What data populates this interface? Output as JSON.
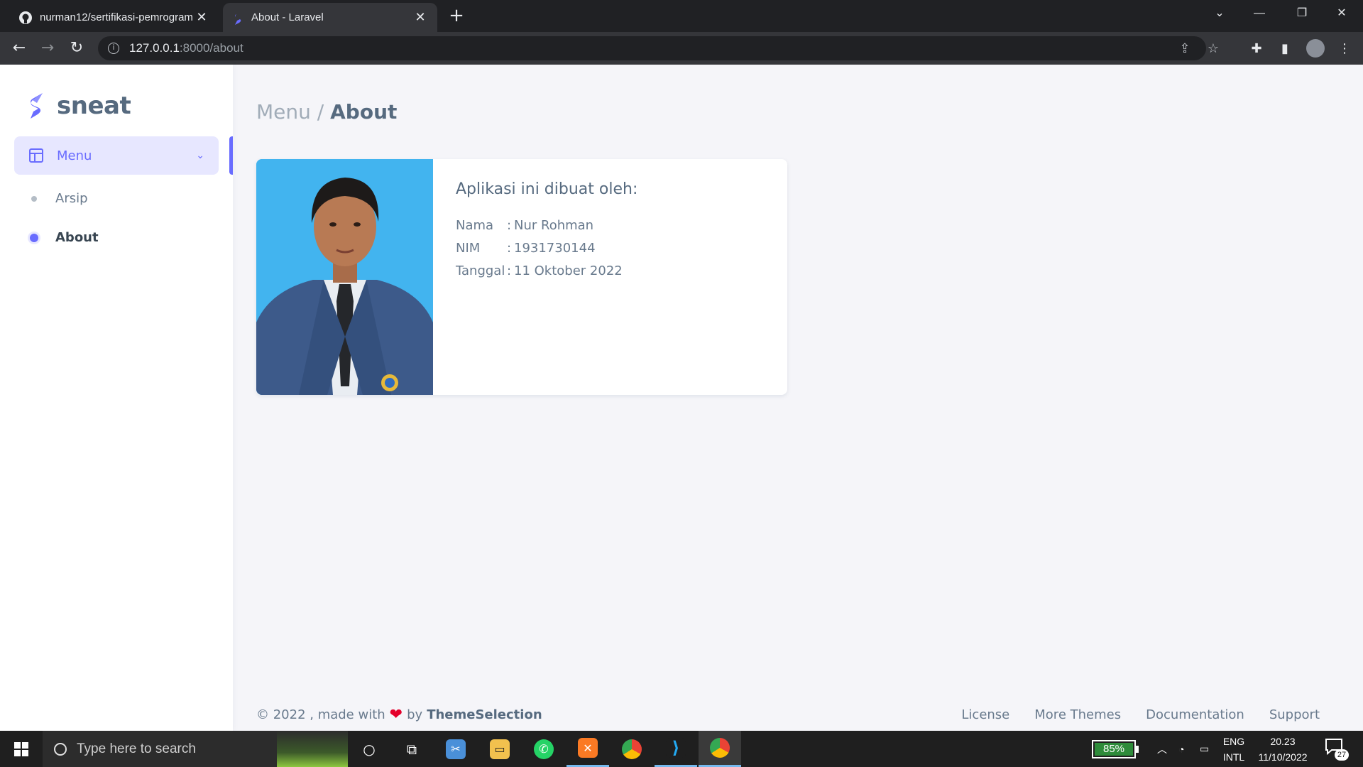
{
  "browser": {
    "tabs": [
      {
        "title": "nurman12/sertifikasi-pemrogram",
        "icon": "github-icon"
      },
      {
        "title": "About - Laravel",
        "icon": "sneat-icon"
      }
    ],
    "url_host": "127.0.0.1",
    "url_path": ":8000/about",
    "window_controls": {
      "minimize": "—",
      "restore": "❐",
      "close": "✕"
    }
  },
  "app": {
    "brand": "sneat",
    "accent": "#696cff",
    "sidebar": {
      "menu_label": "Menu",
      "items": [
        {
          "label": "Arsip",
          "active": false
        },
        {
          "label": "About",
          "active": true
        }
      ]
    },
    "breadcrumb": {
      "parent": "Menu /",
      "current": "About"
    },
    "card": {
      "title": "Aplikasi ini dibuat oleh:",
      "rows": [
        {
          "key": "Nama",
          "sep": ":",
          "value": "Nur Rohman"
        },
        {
          "key": "NIM",
          "sep": ":",
          "value": "1931730144"
        },
        {
          "key": "Tanggal",
          "sep": ":",
          "value": "11 Oktober 2022"
        }
      ]
    },
    "footer": {
      "copyright": "© 2022 , made with",
      "by": "by",
      "company": "ThemeSelection",
      "links": [
        "License",
        "More Themes",
        "Documentation",
        "Support"
      ]
    }
  },
  "taskbar": {
    "search_placeholder": "Type here to search",
    "battery": "85%",
    "lang_line1": "ENG",
    "lang_line2": "INTL",
    "time": "20.23",
    "date": "11/10/2022",
    "notifications": "27"
  }
}
